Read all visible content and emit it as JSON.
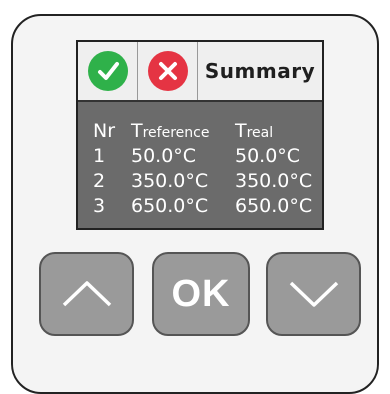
{
  "screen": {
    "title": "Summary",
    "confirm_icon": "checkmark-icon",
    "cancel_icon": "cross-icon"
  },
  "table": {
    "headers": {
      "nr": "Nr",
      "tref_prefix": "T",
      "tref_sub": "reference",
      "treal_prefix": "T",
      "treal_sub": "real"
    },
    "rows": [
      {
        "nr": "1",
        "reference": "50.0°C",
        "real": "50.0°C"
      },
      {
        "nr": "2",
        "reference": "350.0°C",
        "real": "350.0°C"
      },
      {
        "nr": "3",
        "reference": "650.0°C",
        "real": "650.0°C"
      }
    ]
  },
  "buttons": {
    "up_icon": "chevron-up-icon",
    "ok_label": "OK",
    "down_icon": "chevron-down-icon"
  },
  "colors": {
    "screen_bg": "#6b6b6b",
    "confirm": "#2fb14a",
    "cancel": "#e53443",
    "button": "#9a9a9a"
  }
}
